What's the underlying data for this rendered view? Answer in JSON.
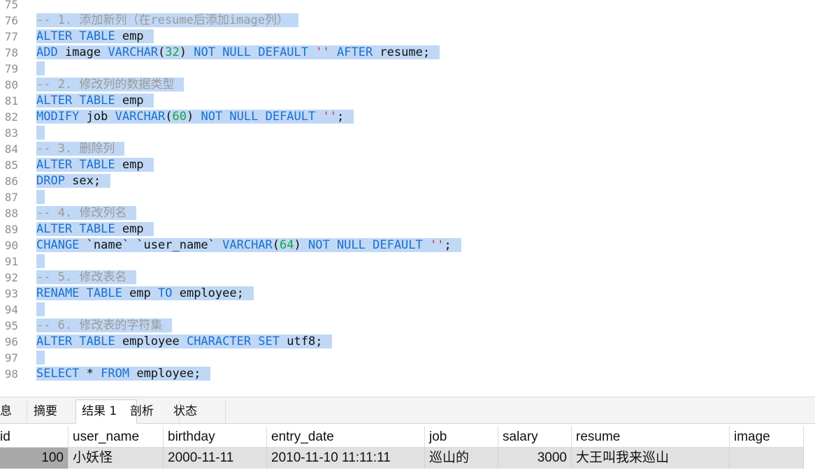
{
  "editor": {
    "lines": [
      {
        "n": "75",
        "sel": false,
        "tokens": []
      },
      {
        "n": "76",
        "sel": true,
        "tokens": [
          {
            "t": "-- 1. 添加新列（在resume后添加image列）",
            "c": "cmt"
          }
        ]
      },
      {
        "n": "77",
        "sel": true,
        "tokens": [
          {
            "t": "ALTER TABLE",
            "c": "kw"
          },
          {
            "t": " emp",
            "c": ""
          }
        ]
      },
      {
        "n": "78",
        "sel": true,
        "tokens": [
          {
            "t": "ADD",
            "c": "kw"
          },
          {
            "t": " image ",
            "c": ""
          },
          {
            "t": "VARCHAR",
            "c": "kw"
          },
          {
            "t": "(",
            "c": ""
          },
          {
            "t": "32",
            "c": "num"
          },
          {
            "t": ") ",
            "c": ""
          },
          {
            "t": "NOT NULL DEFAULT",
            "c": "kw"
          },
          {
            "t": " ",
            "c": ""
          },
          {
            "t": "''",
            "c": "str"
          },
          {
            "t": " ",
            "c": ""
          },
          {
            "t": "AFTER",
            "c": "kw"
          },
          {
            "t": " resume;",
            "c": ""
          }
        ]
      },
      {
        "n": "79",
        "sel": true,
        "tokens": [
          {
            "t": "",
            "c": ""
          }
        ]
      },
      {
        "n": "80",
        "sel": true,
        "tokens": [
          {
            "t": "-- 2. 修改列的数据类型",
            "c": "cmt"
          }
        ]
      },
      {
        "n": "81",
        "sel": true,
        "tokens": [
          {
            "t": "ALTER TABLE",
            "c": "kw"
          },
          {
            "t": " emp",
            "c": ""
          }
        ]
      },
      {
        "n": "82",
        "sel": true,
        "tokens": [
          {
            "t": "MODIFY",
            "c": "kw"
          },
          {
            "t": " job ",
            "c": ""
          },
          {
            "t": "VARCHAR",
            "c": "kw"
          },
          {
            "t": "(",
            "c": ""
          },
          {
            "t": "60",
            "c": "num"
          },
          {
            "t": ") ",
            "c": ""
          },
          {
            "t": "NOT NULL DEFAULT",
            "c": "kw"
          },
          {
            "t": " ",
            "c": ""
          },
          {
            "t": "''",
            "c": "str"
          },
          {
            "t": ";",
            "c": ""
          }
        ]
      },
      {
        "n": "83",
        "sel": true,
        "tokens": [
          {
            "t": "",
            "c": ""
          }
        ]
      },
      {
        "n": "84",
        "sel": true,
        "tokens": [
          {
            "t": "-- 3. 删除列",
            "c": "cmt"
          }
        ]
      },
      {
        "n": "85",
        "sel": true,
        "tokens": [
          {
            "t": "ALTER TABLE",
            "c": "kw"
          },
          {
            "t": " emp",
            "c": ""
          }
        ]
      },
      {
        "n": "86",
        "sel": true,
        "tokens": [
          {
            "t": "DROP",
            "c": "kw"
          },
          {
            "t": " sex;",
            "c": ""
          }
        ]
      },
      {
        "n": "87",
        "sel": true,
        "tokens": [
          {
            "t": "",
            "c": ""
          }
        ]
      },
      {
        "n": "88",
        "sel": true,
        "tokens": [
          {
            "t": "-- 4. 修改列名",
            "c": "cmt"
          }
        ]
      },
      {
        "n": "89",
        "sel": true,
        "tokens": [
          {
            "t": "ALTER TABLE",
            "c": "kw"
          },
          {
            "t": " emp",
            "c": ""
          }
        ]
      },
      {
        "n": "90",
        "sel": true,
        "tokens": [
          {
            "t": "CHANGE",
            "c": "kw"
          },
          {
            "t": " `name` `user_name` ",
            "c": ""
          },
          {
            "t": "VARCHAR",
            "c": "kw"
          },
          {
            "t": "(",
            "c": ""
          },
          {
            "t": "64",
            "c": "num"
          },
          {
            "t": ") ",
            "c": ""
          },
          {
            "t": "NOT NULL DEFAULT",
            "c": "kw"
          },
          {
            "t": " ",
            "c": ""
          },
          {
            "t": "''",
            "c": "str"
          },
          {
            "t": ";",
            "c": ""
          }
        ]
      },
      {
        "n": "91",
        "sel": true,
        "tokens": [
          {
            "t": "",
            "c": ""
          }
        ]
      },
      {
        "n": "92",
        "sel": true,
        "tokens": [
          {
            "t": "-- 5. 修改表名",
            "c": "cmt"
          }
        ]
      },
      {
        "n": "93",
        "sel": true,
        "tokens": [
          {
            "t": "RENAME TABLE",
            "c": "kw"
          },
          {
            "t": " emp ",
            "c": ""
          },
          {
            "t": "TO",
            "c": "kw"
          },
          {
            "t": " employee;",
            "c": ""
          }
        ]
      },
      {
        "n": "94",
        "sel": true,
        "tokens": [
          {
            "t": "",
            "c": ""
          }
        ]
      },
      {
        "n": "95",
        "sel": true,
        "tokens": [
          {
            "t": "-- 6. 修改表的字符集",
            "c": "cmt"
          }
        ]
      },
      {
        "n": "96",
        "sel": true,
        "tokens": [
          {
            "t": "ALTER TABLE",
            "c": "kw"
          },
          {
            "t": " employee ",
            "c": ""
          },
          {
            "t": "CHARACTER SET",
            "c": "kw"
          },
          {
            "t": " utf8;",
            "c": ""
          }
        ]
      },
      {
        "n": "97",
        "sel": true,
        "tokens": [
          {
            "t": "",
            "c": ""
          }
        ]
      },
      {
        "n": "98",
        "sel": true,
        "tokens": [
          {
            "t": "SELECT",
            "c": "kw"
          },
          {
            "t": " * ",
            "c": ""
          },
          {
            "t": "FROM",
            "c": "kw"
          },
          {
            "t": " employee;",
            "c": ""
          }
        ]
      }
    ]
  },
  "tabs": [
    {
      "label": "信息",
      "shown": "息"
    },
    {
      "label": "摘要",
      "shown": "摘要"
    },
    {
      "label": "结果 1",
      "shown": "结果 1"
    },
    {
      "label": "剖析",
      "shown": "剖析"
    },
    {
      "label": "状态",
      "shown": "状态"
    }
  ],
  "active_tab": "结果 1",
  "results": {
    "columns": [
      "id",
      "user_name",
      "birthday",
      "entry_date",
      "job",
      "salary",
      "resume",
      "image"
    ],
    "rows": [
      [
        "100",
        "小妖怪",
        "2000-11-11",
        "2010-11-10 11:11:11",
        "巡山的",
        "3000",
        "大王叫我来巡山",
        ""
      ]
    ]
  }
}
